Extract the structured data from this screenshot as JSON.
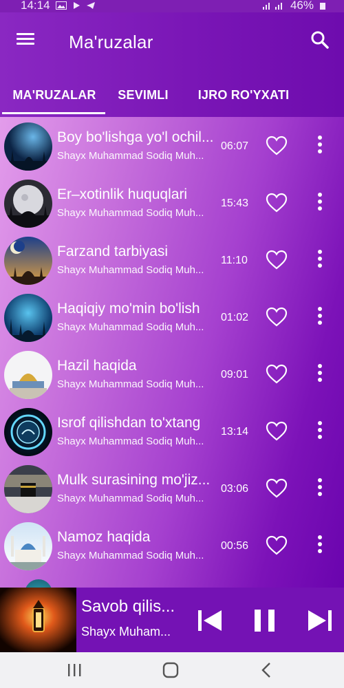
{
  "status_bar": {
    "time": "14:14",
    "battery": "46%"
  },
  "app_bar": {
    "title": "Ma'ruzalar"
  },
  "tabs": [
    {
      "label": "MA'RUZALAR",
      "selected": true
    },
    {
      "label": "SEVIMLI",
      "selected": false
    },
    {
      "label": "IJRO RO'YXATI",
      "selected": false
    }
  ],
  "lectures": [
    {
      "title": "Boy bo'lishga yo'l ochil...",
      "author": "Shayx Muhammad Sodiq Muh...",
      "duration": "06:07"
    },
    {
      "title": "Er–xotinlik huquqlari",
      "author": "Shayx Muhammad Sodiq Muh...",
      "duration": "15:43"
    },
    {
      "title": "Farzand tarbiyasi",
      "author": "Shayx Muhammad Sodiq Muh...",
      "duration": "11:10"
    },
    {
      "title": "Haqiqiy mo'min bo'lish",
      "author": "Shayx Muhammad Sodiq Muh...",
      "duration": "01:02"
    },
    {
      "title": "Hazil haqida",
      "author": "Shayx Muhammad Sodiq Muh...",
      "duration": "09:01"
    },
    {
      "title": "Isrof qilishdan to'xtang",
      "author": "Shayx Muhammad Sodiq Muh...",
      "duration": "13:14"
    },
    {
      "title": "Mulk surasining mo'jiz...",
      "author": "Shayx Muhammad Sodiq Muh...",
      "duration": "03:06"
    },
    {
      "title": "Namoz haqida",
      "author": "Shayx Muhammad Sodiq Muh...",
      "duration": "00:56"
    }
  ],
  "player": {
    "title": "Savob qilis...",
    "author": "Shayx Muham...",
    "state": "playing"
  },
  "colors": {
    "accent": "#7a16b6",
    "player_bg": "#7412b4",
    "list_gradient_start": "#e39ceb",
    "list_gradient_end": "#6a04ae"
  },
  "icons": {
    "menu": "menu-icon",
    "search": "search-icon",
    "favorite": "heart-outline-icon",
    "more": "more-vert-icon",
    "prev": "skip-previous-icon",
    "pause": "pause-icon",
    "next": "skip-next-icon"
  }
}
